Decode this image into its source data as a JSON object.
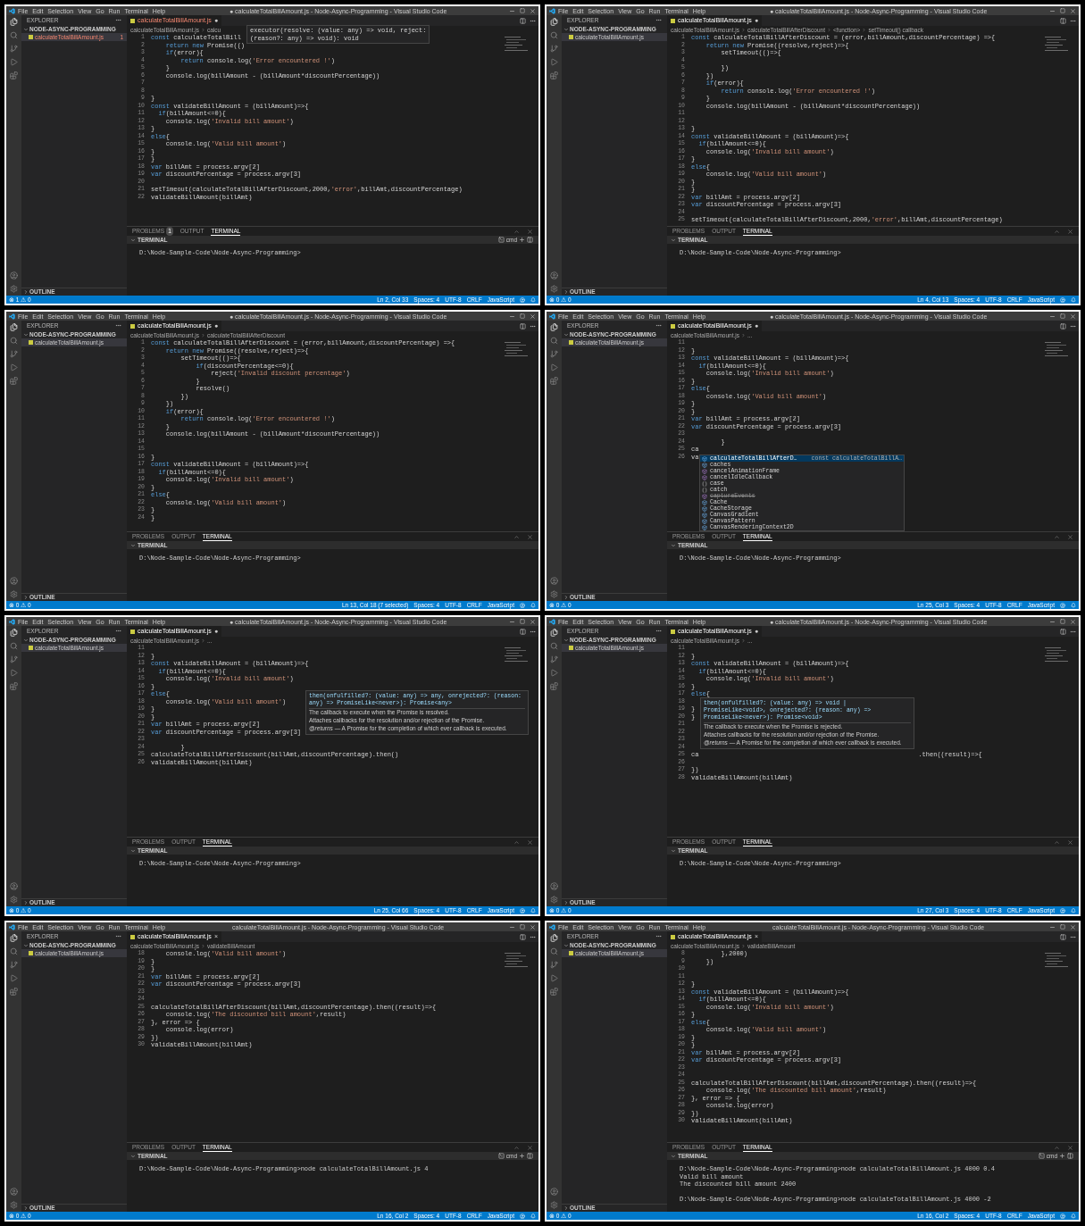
{
  "panels": [
    {
      "menu": [
        "File",
        "Edit",
        "Selection",
        "View",
        "Go",
        "Run",
        "Terminal",
        "Help"
      ],
      "title": "● calculateTotalBillAmount.js - Node-Async-Programming - Visual Studio Code",
      "explorer": {
        "title": "EXPLORER",
        "folder": "NODE-ASYNC-PROGRAMMING",
        "file": {
          "name": "calculateTotalBillAmount.js",
          "has_error": true,
          "badge": "1"
        },
        "outline": "OUTLINE"
      },
      "tab": {
        "name": "calculateTotalBillAmount.js",
        "marker": "●",
        "has_error": true
      },
      "breadcrumb": [
        "calculateTotalBillAmount.js",
        "calcu"
      ],
      "lines": [
        {
          "n": "1",
          "code": "const calculateTotalBill"
        },
        {
          "n": "2",
          "code": "    return new Promise(()"
        },
        {
          "n": "3",
          "code": "    if(error){"
        },
        {
          "n": "4",
          "code": "        return console.log('Error encountered !')"
        },
        {
          "n": "5",
          "code": "    }"
        },
        {
          "n": "6",
          "code": "    console.log(billAmount - (billAmount*discountPercentage))"
        },
        {
          "n": "7"
        },
        {
          "n": "8"
        },
        {
          "n": "9",
          "code": "}"
        },
        {
          "n": "10",
          "code": "const validateBillAmount = (billAmount)=>{"
        },
        {
          "n": "11",
          "code": "  if(billAmount<=0){"
        },
        {
          "n": "12",
          "code": "    console.log('Invalid bill amount')"
        },
        {
          "n": "13",
          "code": "}"
        },
        {
          "n": "14",
          "code": "else{"
        },
        {
          "n": "15",
          "code": "    console.log('Valid bill amount')"
        },
        {
          "n": "16",
          "code": "}"
        },
        {
          "n": "17",
          "code": "}"
        },
        {
          "n": "18",
          "code": "var billAmt = process.argv[2]"
        },
        {
          "n": "19",
          "code": "var discountPercentage = process.argv[3]"
        },
        {
          "n": "20"
        },
        {
          "n": "21",
          "code": "setTimeout(calculateTotalBillAfterDiscount,2000,'error',billAmt,discountPercentage)"
        },
        {
          "n": "22",
          "code": "validateBillAmount(billAmt)"
        }
      ],
      "popup": {
        "kind": "signature",
        "lines": [
          "executor(resolve: (value: any) => void, reject:",
          "(reason?: any) => void): void"
        ]
      },
      "panel_tabs": [
        {
          "label": "PROBLEMS",
          "selected": false,
          "badge": "1"
        },
        {
          "label": "OUTPUT",
          "selected": false
        },
        {
          "label": "TERMINAL",
          "selected": true
        }
      ],
      "terminal": {
        "title": "TERMINAL",
        "shell": "cmd",
        "lines": [
          {
            "kind": "text",
            "text": "D:\\Node-Sample-Code\\Node-Async-Programming>"
          }
        ]
      },
      "status": {
        "problems": "⊗ 1 ⚠ 0",
        "items": [
          "Ln 2, Col 33",
          "Spaces: 4",
          "UTF-8",
          "CRLF",
          "JavaScript"
        ]
      }
    },
    {
      "menu": [
        "File",
        "Edit",
        "Selection",
        "View",
        "Go",
        "Run",
        "Terminal",
        "Help"
      ],
      "title": "● calculateTotalBillAmount.js - Node-Async-Programming - Visual Studio Code",
      "explorer": {
        "title": "EXPLORER",
        "folder": "NODE-ASYNC-PROGRAMMING",
        "file": {
          "name": "calculateTotalBillAmount.js",
          "has_error": false
        },
        "outline": "OUTLINE"
      },
      "tab": {
        "name": "calculateTotalBillAmount.js",
        "marker": "●",
        "has_error": false
      },
      "breadcrumb": [
        "calculateTotalBillAmount.js",
        "calculateTotalBillAfterDiscount",
        "<function>",
        "setTimeout() callback"
      ],
      "lines": [
        {
          "n": "1",
          "code": "const calculateTotalBillAfterDiscount = (error,billAmount,discountPercentage) =>{"
        },
        {
          "n": "2",
          "code": "    return new Promise((resolve,reject)=>{"
        },
        {
          "n": "3",
          "code": "        setTimeout(()=>{"
        },
        {
          "n": "4"
        },
        {
          "n": "5",
          "code": "        })"
        },
        {
          "n": "6",
          "code": "    })"
        },
        {
          "n": "7",
          "code": "    if(error){"
        },
        {
          "n": "8",
          "code": "        return console.log('Error encountered !')"
        },
        {
          "n": "9",
          "code": "    }"
        },
        {
          "n": "10",
          "code": "    console.log(billAmount - (billAmount*discountPercentage))"
        },
        {
          "n": "11"
        },
        {
          "n": "12"
        },
        {
          "n": "13",
          "code": "}"
        },
        {
          "n": "14",
          "code": "const validateBillAmount = (billAmount)=>{"
        },
        {
          "n": "15",
          "code": "  if(billAmount<=0){"
        },
        {
          "n": "16",
          "code": "    console.log('Invalid bill amount')"
        },
        {
          "n": "17",
          "code": "}"
        },
        {
          "n": "18",
          "code": "else{"
        },
        {
          "n": "19",
          "code": "    console.log('Valid bill amount')"
        },
        {
          "n": "20",
          "code": "}"
        },
        {
          "n": "21",
          "code": "}"
        },
        {
          "n": "22",
          "code": "var billAmt = process.argv[2]"
        },
        {
          "n": "23",
          "code": "var discountPercentage = process.argv[3]"
        },
        {
          "n": "24"
        },
        {
          "n": "25",
          "code": "setTimeout(calculateTotalBillAfterDiscount,2000,'error',billAmt,discountPercentage)"
        }
      ],
      "panel_tabs": [
        {
          "label": "PROBLEMS",
          "selected": false
        },
        {
          "label": "OUTPUT",
          "selected": false
        },
        {
          "label": "TERMINAL",
          "selected": true
        }
      ],
      "terminal": {
        "title": "TERMINAL",
        "lines": [
          {
            "kind": "text",
            "text": "D:\\Node-Sample-Code\\Node-Async-Programming>"
          }
        ]
      },
      "status": {
        "problems": "⊗ 0 ⚠ 0",
        "items": [
          "Ln 4, Col 13",
          "Spaces: 4",
          "UTF-8",
          "CRLF",
          "JavaScript"
        ]
      }
    },
    {
      "menu": [
        "File",
        "Edit",
        "Selection",
        "View",
        "Go",
        "Run",
        "Terminal",
        "Help"
      ],
      "title": "● calculateTotalBillAmount.js - Node-Async-Programming - Visual Studio Code",
      "explorer": {
        "title": "EXPLORER",
        "folder": "NODE-ASYNC-PROGRAMMING",
        "file": {
          "name": "calculateTotalBillAmount.js",
          "has_error": false
        },
        "outline": "OUTLINE"
      },
      "tab": {
        "name": "calculateTotalBillAmount.js",
        "marker": "●",
        "has_error": false
      },
      "breadcrumb": [
        "calculateTotalBillAmount.js",
        "calculateTotalBillAfterDiscount"
      ],
      "lines": [
        {
          "n": "1",
          "code": "const calculateTotalBillAfterDiscount = (error,billAmount,discountPercentage) =>{"
        },
        {
          "n": "2",
          "code": "    return new Promise((resolve,reject)=>{"
        },
        {
          "n": "3",
          "code": "        setTimeout(()=>{"
        },
        {
          "n": "4",
          "code": "            if(discountPercentage<=0){"
        },
        {
          "n": "5",
          "code": "                reject('Invalid discount percentage')"
        },
        {
          "n": "6",
          "code": "            }"
        },
        {
          "n": "7",
          "code": "            resolve()"
        },
        {
          "n": "8",
          "code": "        })"
        },
        {
          "n": "9",
          "code": "    })"
        },
        {
          "n": "10",
          "code": "    if(error){"
        },
        {
          "n": "11",
          "code": "        return console.log('Error encountered !')"
        },
        {
          "n": "12",
          "code": "    }"
        },
        {
          "n": "13",
          "code": "    console.log(billAmount - (billAmount*discountPercentage))"
        },
        {
          "n": "14"
        },
        {
          "n": "15"
        },
        {
          "n": "16",
          "code": "}"
        },
        {
          "n": "17",
          "code": "const validateBillAmount = (billAmount)=>{"
        },
        {
          "n": "18",
          "code": "  if(billAmount<=0){"
        },
        {
          "n": "19",
          "code": "    console.log('Invalid bill amount')"
        },
        {
          "n": "20",
          "code": "}"
        },
        {
          "n": "21",
          "code": "else{"
        },
        {
          "n": "22",
          "code": "    console.log('Valid bill amount')"
        },
        {
          "n": "23",
          "code": "}"
        },
        {
          "n": "24",
          "code": "}"
        }
      ],
      "panel_tabs": [
        {
          "label": "PROBLEMS",
          "selected": false
        },
        {
          "label": "OUTPUT",
          "selected": false
        },
        {
          "label": "TERMINAL",
          "selected": true
        }
      ],
      "terminal": {
        "title": "TERMINAL",
        "lines": [
          {
            "kind": "text",
            "text": "D:\\Node-Sample-Code\\Node-Async-Programming>"
          }
        ]
      },
      "status": {
        "problems": "⊗ 0 ⚠ 0",
        "items": [
          "Ln 13, Col 18 (7 selected)",
          "Spaces: 4",
          "UTF-8",
          "CRLF",
          "JavaScript"
        ]
      }
    },
    {
      "menu": [
        "File",
        "Edit",
        "Selection",
        "View",
        "Go",
        "Run",
        "Terminal",
        "Help"
      ],
      "title": "● calculateTotalBillAmount.js - Node-Async-Programming - Visual Studio Code",
      "explorer": {
        "title": "EXPLORER",
        "folder": "NODE-ASYNC-PROGRAMMING",
        "file": {
          "name": "calculateTotalBillAmount.js",
          "has_error": false
        },
        "outline": "OUTLINE"
      },
      "tab": {
        "name": "calculateTotalBillAmount.js",
        "marker": "●",
        "has_error": false
      },
      "breadcrumb": [
        "calculateTotalBillAmount.js",
        "..."
      ],
      "lines": [
        {
          "n": "11"
        },
        {
          "n": "12",
          "code": "}"
        },
        {
          "n": "13",
          "code": "const validateBillAmount = (billAmount)=>{"
        },
        {
          "n": "14",
          "code": "  if(billAmount<=0){"
        },
        {
          "n": "15",
          "code": "    console.log('Invalid bill amount')"
        },
        {
          "n": "16",
          "code": "}"
        },
        {
          "n": "17",
          "code": "else{"
        },
        {
          "n": "18",
          "code": "    console.log('Valid bill amount')"
        },
        {
          "n": "19",
          "code": "}"
        },
        {
          "n": "20",
          "code": "}"
        },
        {
          "n": "21",
          "code": "var billAmt = process.argv[2]"
        },
        {
          "n": "22",
          "code": "var discountPercentage = process.argv[3]"
        },
        {
          "n": "23"
        },
        {
          "n": "24",
          "code": "        }"
        },
        {
          "n": "25",
          "code": "ca"
        },
        {
          "n": "26",
          "code": "va"
        }
      ],
      "popup": {
        "kind": "suggest",
        "items": [
          {
            "label": "calculateTotalBillAfterD…",
            "detail": "const calculateTotalBillA…",
            "kind": "variable",
            "selected": true
          },
          {
            "label": "caches",
            "kind": "variable",
            "selected": false
          },
          {
            "label": "cancelAnimationFrame",
            "kind": "method",
            "selected": false
          },
          {
            "label": "cancelIdleCallback",
            "kind": "method",
            "selected": false
          },
          {
            "label": "case",
            "kind": "keyword",
            "selected": false
          },
          {
            "label": "catch",
            "kind": "keyword",
            "selected": false
          },
          {
            "label": "captureEvents",
            "kind": "method",
            "deprecated": true,
            "selected": false
          },
          {
            "label": "Cache",
            "kind": "variable",
            "selected": false
          },
          {
            "label": "CacheStorage",
            "kind": "variable",
            "selected": false
          },
          {
            "label": "CanvasGradient",
            "kind": "variable",
            "selected": false
          },
          {
            "label": "CanvasPattern",
            "kind": "variable",
            "selected": false
          },
          {
            "label": "CanvasRenderingContext2D",
            "kind": "variable",
            "selected": false
          }
        ]
      },
      "panel_tabs": [
        {
          "label": "PROBLEMS",
          "selected": false
        },
        {
          "label": "OUTPUT",
          "selected": false
        },
        {
          "label": "TERMINAL",
          "selected": true
        }
      ],
      "terminal": {
        "title": "TERMINAL",
        "lines": [
          {
            "kind": "text",
            "text": "D:\\Node-Sample-Code\\Node-Async-Programming>"
          }
        ]
      },
      "status": {
        "problems": "⊗ 0 ⚠ 0",
        "items": [
          "Ln 25, Col 3",
          "Spaces: 4",
          "UTF-8",
          "CRLF",
          "JavaScript"
        ]
      }
    },
    {
      "menu": [
        "File",
        "Edit",
        "Selection",
        "View",
        "Go",
        "Run",
        "Terminal",
        "Help"
      ],
      "title": "● calculateTotalBillAmount.js - Node-Async-Programming - Visual Studio Code",
      "explorer": {
        "title": "EXPLORER",
        "folder": "NODE-ASYNC-PROGRAMMING",
        "file": {
          "name": "calculateTotalBillAmount.js",
          "has_error": false
        },
        "outline": "OUTLINE"
      },
      "tab": {
        "name": "calculateTotalBillAmount.js",
        "marker": "●",
        "has_error": false
      },
      "breadcrumb": [
        "calculateTotalBillAmount.js",
        "..."
      ],
      "lines": [
        {
          "n": "11"
        },
        {
          "n": "12",
          "code": "}"
        },
        {
          "n": "13",
          "code": "const validateBillAmount = (billAmount)=>{"
        },
        {
          "n": "14",
          "code": "  if(billAmount<=0){"
        },
        {
          "n": "15",
          "code": "    console.log('Invalid bill amount')"
        },
        {
          "n": "16",
          "code": "}"
        },
        {
          "n": "17",
          "code": "else{"
        },
        {
          "n": "18",
          "code": "    console.log('Valid bill amount')"
        },
        {
          "n": "19",
          "code": "}"
        },
        {
          "n": "20",
          "code": "}"
        },
        {
          "n": "21",
          "code": "var billAmt = process.argv[2]"
        },
        {
          "n": "22",
          "code": "var discountPercentage = process.argv[3]"
        },
        {
          "n": "23"
        },
        {
          "n": "24",
          "code": "        }"
        },
        {
          "n": "25",
          "code": "calculateTotalBillAfterDiscount(billAmt,discountPercentage).then()"
        },
        {
          "n": "26",
          "code": "validateBillAmount(billAmt)"
        }
      ],
      "popup": {
        "kind": "hover",
        "signature": "then(onfulfilled?: (value: any) => any, onrejected?: (reason: any) => PromiseLike<never>): Promise<any>",
        "description": "The callback to execute when the Promise is resolved.",
        "summary": "Attaches callbacks for the resolution and/or rejection of the Promise.",
        "returns": "*@returns* — A Promise for the completion of which ever callback is executed."
      },
      "panel_tabs": [
        {
          "label": "PROBLEMS",
          "selected": false
        },
        {
          "label": "OUTPUT",
          "selected": false
        },
        {
          "label": "TERMINAL",
          "selected": true
        }
      ],
      "terminal": {
        "title": "TERMINAL",
        "lines": [
          {
            "kind": "text",
            "text": "D:\\Node-Sample-Code\\Node-Async-Programming>"
          }
        ]
      },
      "status": {
        "problems": "⊗ 0 ⚠ 0",
        "items": [
          "Ln 25, Col 66",
          "Spaces: 4",
          "UTF-8",
          "CRLF",
          "JavaScript"
        ]
      }
    },
    {
      "menu": [
        "File",
        "Edit",
        "Selection",
        "View",
        "Go",
        "Run",
        "Terminal",
        "Help"
      ],
      "title": "● calculateTotalBillAmount.js - Node-Async-Programming - Visual Studio Code",
      "explorer": {
        "title": "EXPLORER",
        "folder": "NODE-ASYNC-PROGRAMMING",
        "file": {
          "name": "calculateTotalBillAmount.js",
          "has_error": false
        },
        "outline": "OUTLINE"
      },
      "tab": {
        "name": "calculateTotalBillAmount.js",
        "marker": "●",
        "has_error": false
      },
      "breadcrumb": [
        "calculateTotalBillAmount.js",
        "..."
      ],
      "lines": [
        {
          "n": "11"
        },
        {
          "n": "12",
          "code": "}"
        },
        {
          "n": "13",
          "code": "const validateBillAmount = (billAmount)=>{"
        },
        {
          "n": "14",
          "code": "  if(billAmount<=0){"
        },
        {
          "n": "15",
          "code": "    console.log('Invalid bill amount')"
        },
        {
          "n": "16",
          "code": "}"
        },
        {
          "n": "17",
          "code": "else{"
        },
        {
          "n": "18"
        },
        {
          "n": "19",
          "code": "}"
        },
        {
          "n": "20",
          "code": "}"
        },
        {
          "n": "21"
        },
        {
          "n": "22"
        },
        {
          "n": "23"
        },
        {
          "n": "24"
        },
        {
          "n": "25",
          "code": "ca",
          "tail": ".then((result)=>{"
        },
        {
          "n": "26"
        },
        {
          "n": "27",
          "code": "})"
        },
        {
          "n": "28",
          "code": "validateBillAmount(billAmt)"
        }
      ],
      "popup": {
        "kind": "hover",
        "signature": "then(onfulfilled?: (value: any) => void | PromiseLike<void>, onrejected?: (reason: any) => PromiseLike<never>): Promise<void>",
        "description": "The callback to execute when the Promise is rejected.",
        "summary": "Attaches callbacks for the resolution and/or rejection of the Promise.",
        "returns": "*@returns* — A Promise for the completion of which ever callback is executed."
      },
      "panel_tabs": [
        {
          "label": "PROBLEMS",
          "selected": false
        },
        {
          "label": "OUTPUT",
          "selected": false
        },
        {
          "label": "TERMINAL",
          "selected": true
        }
      ],
      "terminal": {
        "title": "TERMINAL",
        "lines": [
          {
            "kind": "text",
            "text": "D:\\Node-Sample-Code\\Node-Async-Programming>"
          }
        ]
      },
      "status": {
        "problems": "⊗ 0 ⚠ 0",
        "items": [
          "Ln 27, Col 3",
          "Spaces: 4",
          "UTF-8",
          "CRLF",
          "JavaScript"
        ]
      }
    },
    {
      "menu": [
        "File",
        "Edit",
        "Selection",
        "View",
        "Go",
        "Run",
        "Terminal",
        "Help"
      ],
      "title": "calculateTotalBillAmount.js - Node-Async-Programming - Visual Studio Code",
      "explorer": {
        "title": "EXPLORER",
        "folder": "NODE-ASYNC-PROGRAMMING",
        "file": {
          "name": "calculateTotalBillAmount.js",
          "has_error": false
        },
        "outline": "OUTLINE"
      },
      "tab": {
        "name": "calculateTotalBillAmount.js",
        "marker": "×",
        "has_error": false
      },
      "breadcrumb": [
        "calculateTotalBillAmount.js",
        "validateBillAmount"
      ],
      "lines": [
        {
          "n": "18",
          "code": "    console.log('Valid bill amount')"
        },
        {
          "n": "19",
          "code": "}"
        },
        {
          "n": "20",
          "code": "}"
        },
        {
          "n": "21",
          "code": "var billAmt = process.argv[2]"
        },
        {
          "n": "22",
          "code": "var discountPercentage = process.argv[3]"
        },
        {
          "n": "23"
        },
        {
          "n": "24"
        },
        {
          "n": "25",
          "code": "calculateTotalBillAfterDiscount(billAmt,discountPercentage).then((result)=>{"
        },
        {
          "n": "26",
          "code": "    console.log('The discounted bill amount',result)"
        },
        {
          "n": "27",
          "code": "}, error => {"
        },
        {
          "n": "28",
          "code": "    console.log(error)"
        },
        {
          "n": "29",
          "code": "})"
        },
        {
          "n": "30",
          "code": "validateBillAmount(billAmt)"
        }
      ],
      "panel_tabs": [
        {
          "label": "PROBLEMS",
          "selected": false
        },
        {
          "label": "OUTPUT",
          "selected": false
        },
        {
          "label": "TERMINAL",
          "selected": true
        }
      ],
      "terminal": {
        "title": "TERMINAL",
        "shell": "cmd",
        "lines": [
          {
            "kind": "text",
            "text": "D:\\Node-Sample-Code\\Node-Async-Programming>node calculateTotalBillAmount.js 4"
          }
        ]
      },
      "status": {
        "problems": "⊗ 0 ⚠ 0",
        "items": [
          "Ln 16, Col 2",
          "Spaces: 4",
          "UTF-8",
          "CRLF",
          "JavaScript"
        ]
      }
    },
    {
      "menu": [
        "File",
        "Edit",
        "Selection",
        "View",
        "Go",
        "Run",
        "Terminal",
        "Help"
      ],
      "title": "calculateTotalBillAmount.js - Node-Async-Programming - Visual Studio Code",
      "explorer": {
        "title": "EXPLORER",
        "folder": "NODE-ASYNC-PROGRAMMING",
        "file": {
          "name": "calculateTotalBillAmount.js",
          "has_error": false
        },
        "outline": "OUTLINE"
      },
      "tab": {
        "name": "calculateTotalBillAmount.js",
        "marker": "×",
        "has_error": false
      },
      "breadcrumb": [
        "calculateTotalBillAmount.js",
        "validateBillAmount"
      ],
      "lines": [
        {
          "n": "8",
          "code": "        },2000)"
        },
        {
          "n": "9",
          "code": "    })"
        },
        {
          "n": "10"
        },
        {
          "n": "11"
        },
        {
          "n": "12",
          "code": "}"
        },
        {
          "n": "13",
          "code": "const validateBillAmount = (billAmount)=>{"
        },
        {
          "n": "14",
          "code": "  if(billAmount<=0){"
        },
        {
          "n": "15",
          "code": "    console.log('Invalid bill amount')"
        },
        {
          "n": "16",
          "code": "}"
        },
        {
          "n": "17",
          "code": "else{"
        },
        {
          "n": "18",
          "code": "    console.log('Valid bill amount')"
        },
        {
          "n": "19",
          "code": "}"
        },
        {
          "n": "20",
          "code": "}"
        },
        {
          "n": "21",
          "code": "var billAmt = process.argv[2]"
        },
        {
          "n": "22",
          "code": "var discountPercentage = process.argv[3]"
        },
        {
          "n": "23"
        },
        {
          "n": "24"
        },
        {
          "n": "25",
          "code": "calculateTotalBillAfterDiscount(billAmt,discountPercentage).then((result)=>{"
        },
        {
          "n": "26",
          "code": "    console.log('The discounted bill amount',result)"
        },
        {
          "n": "27",
          "code": "}, error => {"
        },
        {
          "n": "28",
          "code": "    console.log(error)"
        },
        {
          "n": "29",
          "code": "})"
        },
        {
          "n": "30",
          "code": "validateBillAmount(billAmt)"
        }
      ],
      "panel_tabs": [
        {
          "label": "PROBLEMS",
          "selected": false
        },
        {
          "label": "OUTPUT",
          "selected": false
        },
        {
          "label": "TERMINAL",
          "selected": true
        }
      ],
      "terminal": {
        "title": "TERMINAL",
        "shell": "cmd",
        "lines": [
          {
            "kind": "text",
            "text": "D:\\Node-Sample-Code\\Node-Async-Programming>node calculateTotalBillAmount.js 4000 0.4"
          },
          {
            "kind": "text",
            "text": "Valid bill amount"
          },
          {
            "kind": "text",
            "text": "The discounted bill amount 2400"
          },
          {
            "kind": "blank"
          },
          {
            "kind": "text",
            "text": "D:\\Node-Sample-Code\\Node-Async-Programming>node calculateTotalBillAmount.js 4000 -2"
          }
        ]
      },
      "status": {
        "problems": "⊗ 0 ⚠ 0",
        "items": [
          "Ln 16, Col 2",
          "Spaces: 4",
          "UTF-8",
          "CRLF",
          "JavaScript"
        ]
      }
    }
  ]
}
